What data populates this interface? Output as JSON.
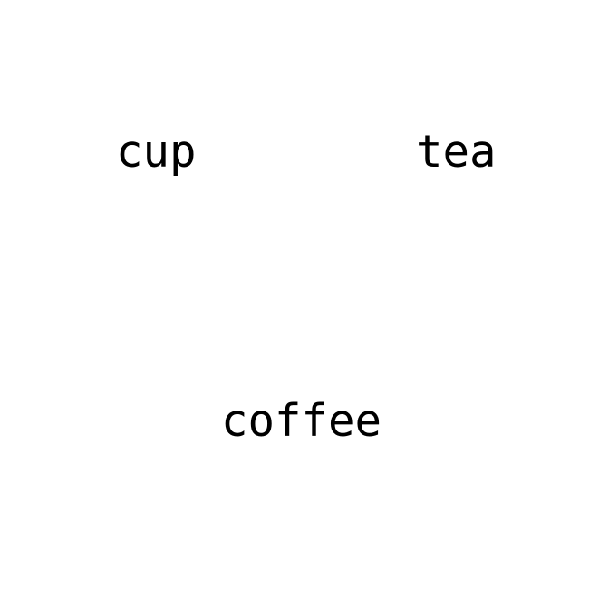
{
  "words": {
    "cup": "cup",
    "tea": "tea",
    "coffee": "coffee"
  },
  "colors": {
    "background": "#ffffff",
    "text": "#000000"
  }
}
